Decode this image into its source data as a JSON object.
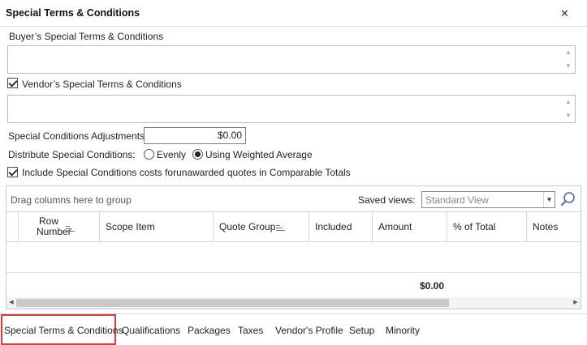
{
  "dialog": {
    "title": "Special Terms & Conditions",
    "close_icon": "close-icon"
  },
  "buyer": {
    "label": "Buyer’s Special Terms & Conditions",
    "value": ""
  },
  "vendor": {
    "label": "Vendor’s Special Terms & Conditions",
    "checked": true,
    "value": ""
  },
  "adjustments": {
    "label": "Special Conditions Adjustments:",
    "value": "$0.00"
  },
  "distribute": {
    "label": "Distribute Special Conditions:",
    "options": [
      "Evenly",
      "Using Weighted Average"
    ],
    "selected": "Using Weighted Average"
  },
  "include_costs": {
    "label": "Include Special Conditions costs forunawarded quotes in Comparable Totals",
    "checked": true
  },
  "grid": {
    "group_hint": "Drag columns here to group",
    "saved_views_label": "Saved views:",
    "saved_view": "Standard View",
    "columns": {
      "row_number_1": "Row",
      "row_number_2": "Number",
      "scope_item": "Scope Item",
      "quote_group": "Quote Group",
      "included": "Included",
      "amount": "Amount",
      "pct_total": "% of Total",
      "notes": "Notes"
    },
    "total_amount": "$0.00"
  },
  "tabs": [
    "Special Terms & Conditions",
    "Qualifications",
    "Packages",
    "Taxes",
    "Vendor's Profile",
    "Setup",
    "Minority"
  ],
  "active_tab": "Special Terms & Conditions",
  "colors": {
    "active_tab_border": "#e0393b"
  }
}
